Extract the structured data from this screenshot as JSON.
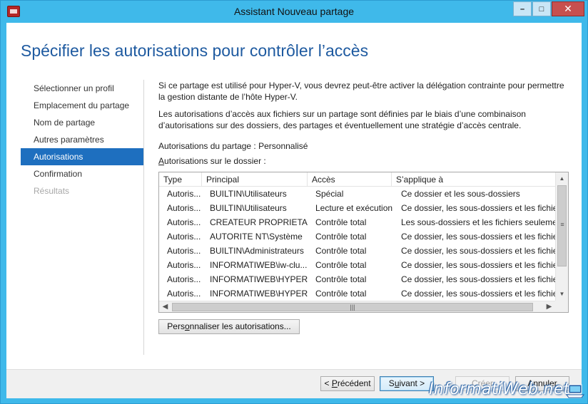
{
  "window": {
    "title": "Assistant Nouveau partage",
    "min_glyph": "–",
    "max_glyph": "□",
    "close_glyph": "✕"
  },
  "heading": "Spécifier les autorisations pour contrôler l’accès",
  "nav": {
    "items": [
      {
        "label": "Sélectionner un profil",
        "state": "normal"
      },
      {
        "label": "Emplacement du partage",
        "state": "normal"
      },
      {
        "label": "Nom de partage",
        "state": "normal"
      },
      {
        "label": "Autres paramètres",
        "state": "normal"
      },
      {
        "label": "Autorisations",
        "state": "active"
      },
      {
        "label": "Confirmation",
        "state": "normal"
      },
      {
        "label": "Résultats",
        "state": "disabled"
      }
    ]
  },
  "content": {
    "para1": "Si ce partage est utilisé pour Hyper-V, vous devrez peut-être activer la délégation contrainte pour permettre la gestion distante de l’hôte Hyper-V.",
    "para2": "Les autorisations d’accès aux fichiers sur un partage sont définies par le biais d’une combinaison d’autorisations sur des dossiers, des partages et éventuellement une stratégie d’accès centrale.",
    "share_perm_label": "Autorisations du partage :",
    "share_perm_value": "Personnalisé",
    "folder_perm_prefix": "A",
    "folder_perm_rest": "utorisations sur le dossier :"
  },
  "table": {
    "columns": [
      "Type",
      "Principal",
      "Accès",
      "S’applique à"
    ],
    "rows": [
      [
        "Autoris...",
        "BUILTIN\\Utilisateurs",
        "Spécial",
        "Ce dossier et les sous-dossiers"
      ],
      [
        "Autoris...",
        "BUILTIN\\Utilisateurs",
        "Lecture et exécution",
        "Ce dossier, les sous-dossiers et les fichiers"
      ],
      [
        "Autoris...",
        "CREATEUR PROPRIETAI...",
        "Contrôle total",
        "Les sous-dossiers et les fichiers seulement"
      ],
      [
        "Autoris...",
        "AUTORITE NT\\Système",
        "Contrôle total",
        "Ce dossier, les sous-dossiers et les fichiers"
      ],
      [
        "Autoris...",
        "BUILTIN\\Administrateurs",
        "Contrôle total",
        "Ce dossier, les sous-dossiers et les fichiers"
      ],
      [
        "Autoris...",
        "INFORMATIWEB\\iw-clu...",
        "Contrôle total",
        "Ce dossier, les sous-dossiers et les fichiers"
      ],
      [
        "Autoris...",
        "INFORMATIWEB\\HYPER...",
        "Contrôle total",
        "Ce dossier, les sous-dossiers et les fichiers"
      ],
      [
        "Autoris...",
        "INFORMATIWEB\\HYPER...",
        "Contrôle total",
        "Ce dossier, les sous-dossiers et les fichiers"
      ]
    ]
  },
  "buttons": {
    "customize_prefix": "Pers",
    "customize_u": "o",
    "customize_rest": "nnaliser les autorisations...",
    "prev_prefix": "< ",
    "prev_u": "P",
    "prev_rest": "récédent",
    "next_prefix": "S",
    "next_u": "u",
    "next_rest": "ivant >",
    "create": "Créer",
    "cancel": "Annuler"
  },
  "watermark": "InformatiWeb.net"
}
